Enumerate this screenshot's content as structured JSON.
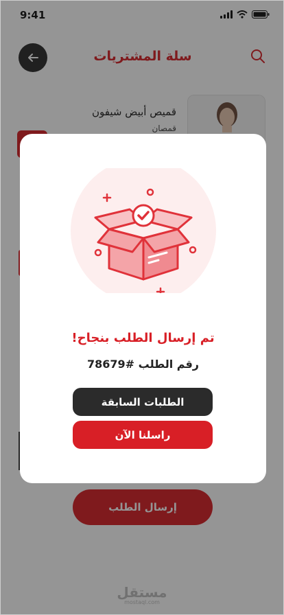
{
  "status_bar": {
    "time": "9:41"
  },
  "header": {
    "title": "سلة المشتريات"
  },
  "cart": {
    "items": [
      {
        "name": "قميص أبيض شيفون",
        "category": "قمصان"
      }
    ]
  },
  "footer": {
    "submit_label": "إرسال الطلب"
  },
  "watermark": {
    "main": "مستقل",
    "sub": "mostaql.com"
  },
  "modal": {
    "title": "تم إرسال الطلب بنجاح!",
    "order_number": "رقم الطلب #78679",
    "previous_orders_label": "الطلبات السابقة",
    "contact_label": "راسلنا الآن"
  },
  "colors": {
    "accent": "#d81f26",
    "dark": "#2b2b2b"
  },
  "icons": [
    "signal-icon",
    "wifi-icon",
    "battery-icon",
    "back-arrow-icon",
    "search-icon",
    "open-box-check-icon"
  ]
}
